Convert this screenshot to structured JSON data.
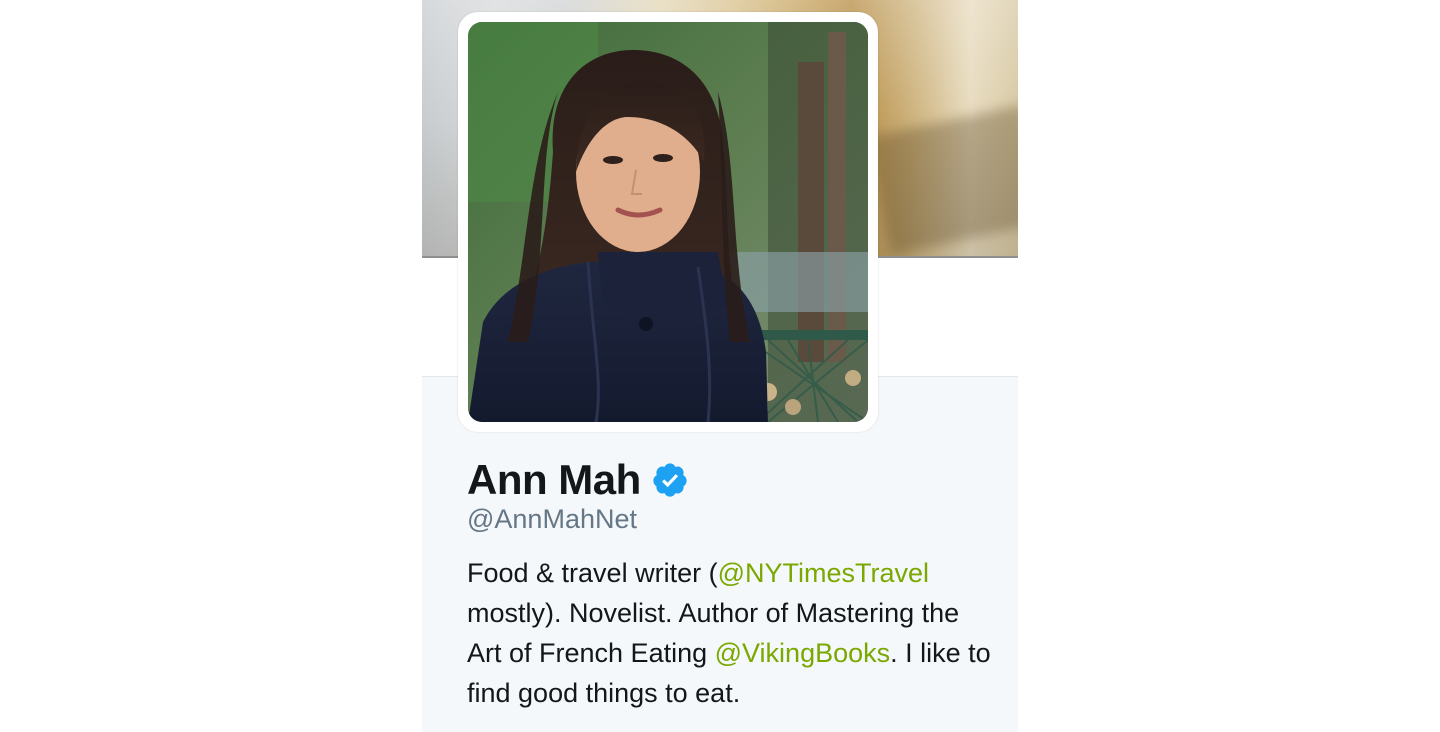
{
  "header": {
    "photo": "header-photo"
  },
  "profile": {
    "avatar": "profile-photo",
    "name": "Ann Mah",
    "verified_icon": "verified-badge-icon",
    "handle": "@AnnMahNet",
    "bio": {
      "part1": "Food & travel writer (",
      "mention1": "@NYTimesTravel",
      "part2": " mostly). Novelist. Author of Mastering the Art of French Eating ",
      "mention2": "@VikingBooks",
      "part3": ". I like to find good things to eat."
    }
  },
  "colors": {
    "link": "#7ba800",
    "verified": "#1da1f2",
    "text": "#14171a",
    "muted": "#657786",
    "card_background": "#f5f8fa"
  }
}
